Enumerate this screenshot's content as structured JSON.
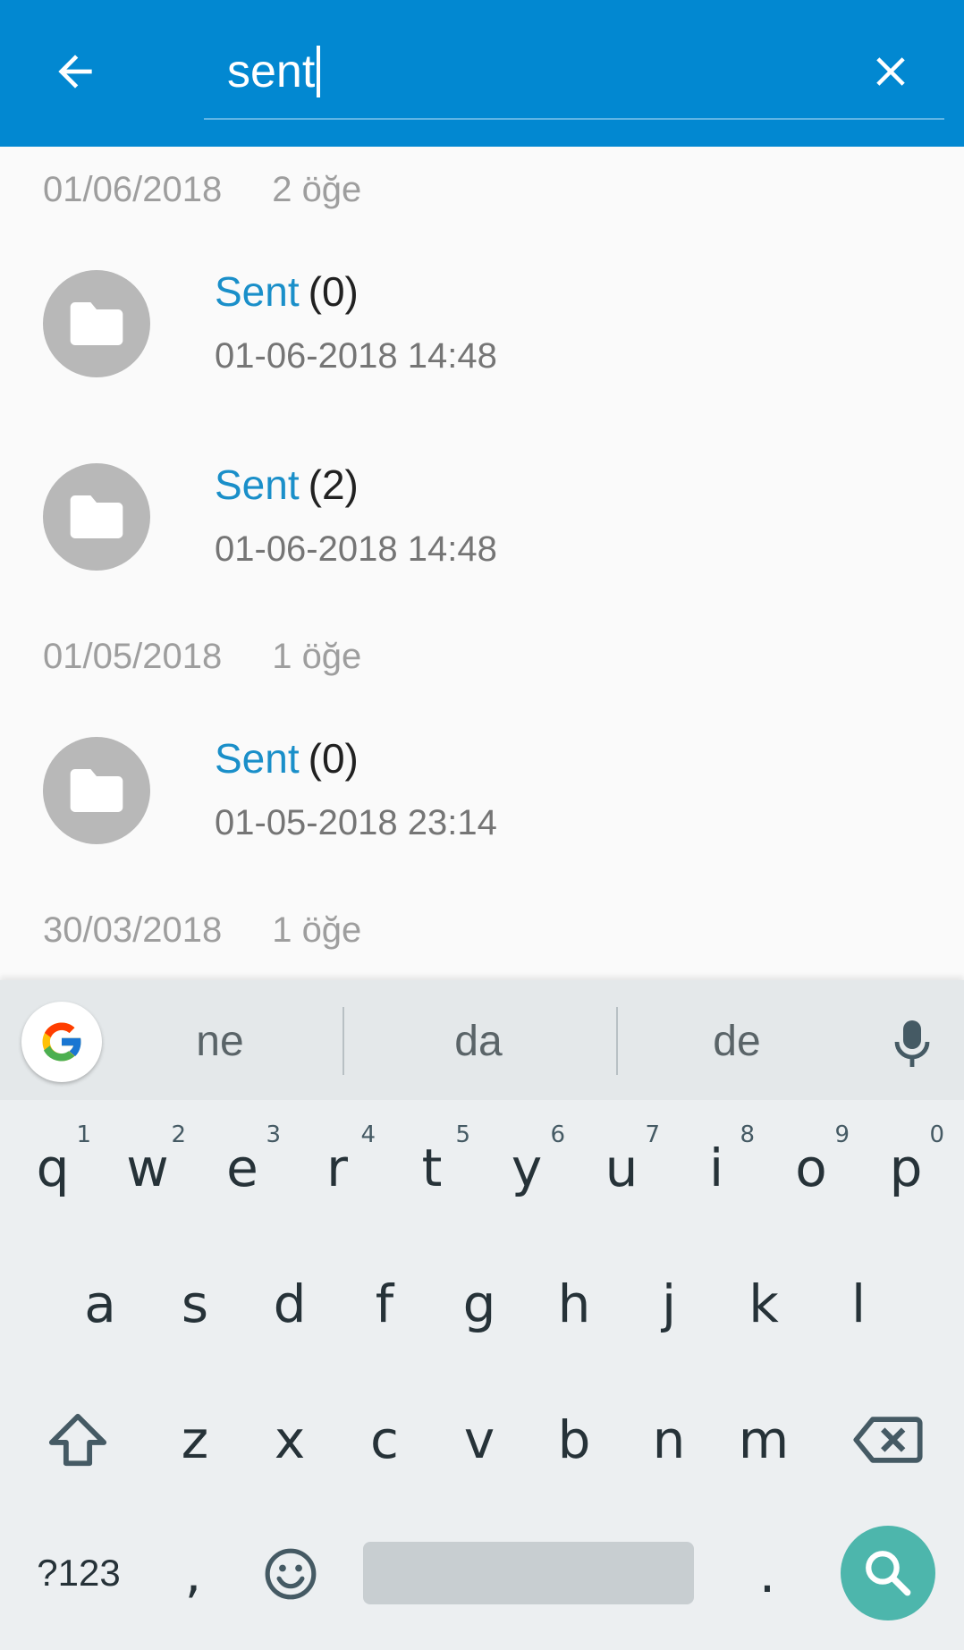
{
  "appbar": {
    "search_value": "sent",
    "colors": {
      "bar": "#0288d1",
      "text": "#ffffff"
    },
    "icons": {
      "back": "arrow-back-icon",
      "clear": "close-icon"
    }
  },
  "list": {
    "sections": [
      {
        "date": "01/06/2018",
        "count": "2 öğe",
        "items": [
          {
            "name": "Sent",
            "count": "(0)",
            "datetime": "01-06-2018 14:48"
          },
          {
            "name": "Sent",
            "count": "(2)",
            "datetime": "01-06-2018 14:48"
          }
        ]
      },
      {
        "date": "01/05/2018",
        "count": "1 öğe",
        "items": [
          {
            "name": "Sent",
            "count": "(0)",
            "datetime": "01-05-2018 23:14"
          }
        ]
      },
      {
        "date": "30/03/2018",
        "count": "1 öğe",
        "items": []
      }
    ],
    "accent_color": "#1a8fc9"
  },
  "keyboard": {
    "suggestions": [
      "ne",
      "da",
      "de"
    ],
    "row1": [
      {
        "k": "q",
        "h": "1"
      },
      {
        "k": "w",
        "h": "2"
      },
      {
        "k": "e",
        "h": "3"
      },
      {
        "k": "r",
        "h": "4"
      },
      {
        "k": "t",
        "h": "5"
      },
      {
        "k": "y",
        "h": "6"
      },
      {
        "k": "u",
        "h": "7"
      },
      {
        "k": "i",
        "h": "8"
      },
      {
        "k": "o",
        "h": "9"
      },
      {
        "k": "p",
        "h": "0"
      }
    ],
    "row2": [
      "a",
      "s",
      "d",
      "f",
      "g",
      "h",
      "j",
      "k",
      "l"
    ],
    "row3": [
      "z",
      "x",
      "c",
      "v",
      "b",
      "n",
      "m"
    ],
    "symbols_label": "?123",
    "comma": ",",
    "period": ".",
    "icons": {
      "google": "google-icon",
      "mic": "mic-icon",
      "shift": "shift-icon",
      "backspace": "backspace-icon",
      "emoji": "emoji-icon",
      "search": "search-icon"
    },
    "action_color": "#4db6ac"
  }
}
